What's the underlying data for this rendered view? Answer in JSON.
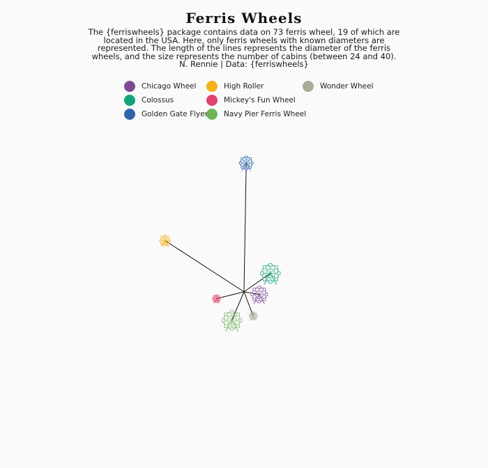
{
  "chart_data": {
    "type": "radial-segments",
    "title": "Ferris Wheels",
    "subtitle": "The {ferriswheels} package contains data on 73 ferris wheel, 19 of which are located in the USA. Here, only ferris wheels with known diameters are represented. The length of the lines represents the diameter of the ferris wheels, and the size represents the number of cabins (between 24 and 40).  N. Rennie | Data: {ferriswheels}",
    "legend_position": "top",
    "legend": [
      {
        "name": "Chicago Wheel",
        "color": "#7d4a97"
      },
      {
        "name": "Colossus",
        "color": "#13a37a"
      },
      {
        "name": "Golden Gate Flyer",
        "color": "#2f64ad"
      },
      {
        "name": "High Roller",
        "color": "#f2b21b"
      },
      {
        "name": "Mickey's Fun Wheel",
        "color": "#e0436c"
      },
      {
        "name": "Navy Pier Ferris Wheel",
        "color": "#6fb457"
      },
      {
        "name": "Wonder Wheel",
        "color": "#a6ad98"
      }
    ],
    "series": [
      {
        "name": "Golden Gate Flyer",
        "diameter_rel": 1.0,
        "angle_deg": 89,
        "cabins": 32
      },
      {
        "name": "High Roller",
        "diameter_rel": 0.73,
        "angle_deg": 147,
        "cabins": 28
      },
      {
        "name": "Colossus",
        "diameter_rel": 0.25,
        "angle_deg": 35,
        "cabins": 40
      },
      {
        "name": "Chicago Wheel",
        "diameter_rel": 0.12,
        "angle_deg": -10,
        "cabins": 36
      },
      {
        "name": "Mickey's Fun Wheel",
        "diameter_rel": 0.22,
        "angle_deg": 194,
        "cabins": 24
      },
      {
        "name": "Navy Pier Ferris Wheel",
        "diameter_rel": 0.24,
        "angle_deg": 247,
        "cabins": 40
      },
      {
        "name": "Wonder Wheel",
        "diameter_rel": 0.2,
        "angle_deg": 291,
        "cabins": 24
      }
    ]
  }
}
